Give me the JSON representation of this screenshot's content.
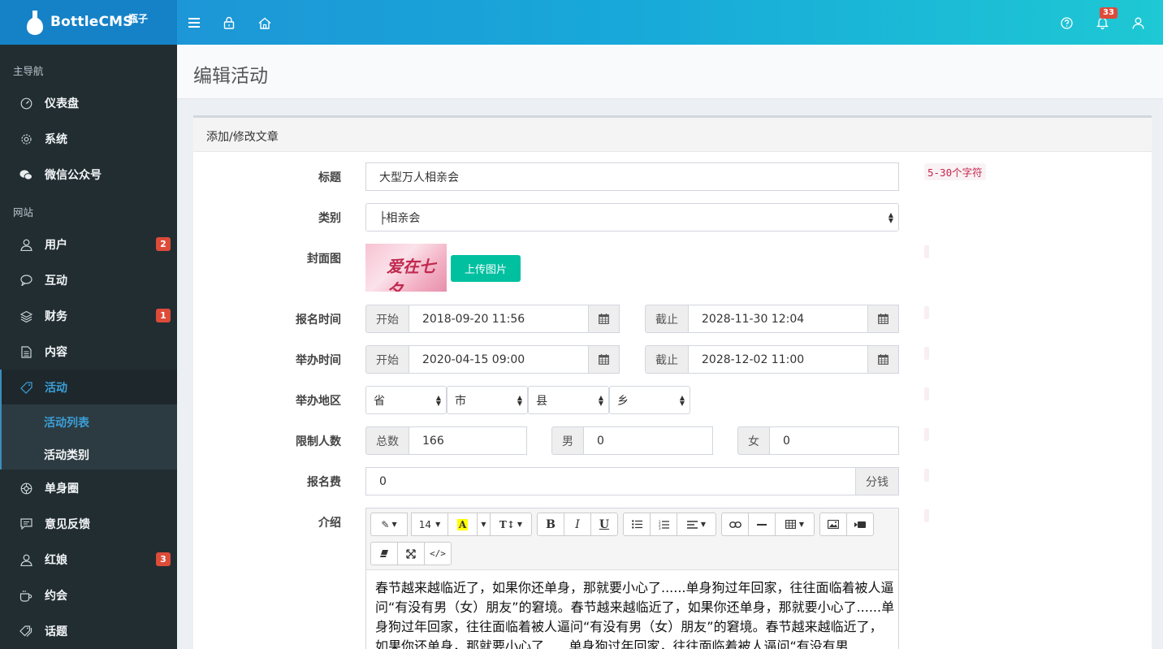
{
  "app": {
    "name": "BottleCMS",
    "name_cn": "瓶子",
    "notification_count": "33"
  },
  "sidebar": {
    "header_main": "主导航",
    "header_site": "网站",
    "items": [
      {
        "label": "仪表盘",
        "icon": "dashboard-icon"
      },
      {
        "label": "系统",
        "icon": "gear-icon"
      },
      {
        "label": "微信公众号",
        "icon": "wechat-icon"
      },
      {
        "label": "用户",
        "icon": "user-icon",
        "badge": "2"
      },
      {
        "label": "互动",
        "icon": "comment-icon"
      },
      {
        "label": "财务",
        "icon": "layers-icon",
        "badge": "1"
      },
      {
        "label": "内容",
        "icon": "file-icon"
      },
      {
        "label": "活动",
        "icon": "tag-icon"
      },
      {
        "label": "单身圈",
        "icon": "circle-icon"
      },
      {
        "label": "意见反馈",
        "icon": "message-icon"
      },
      {
        "label": "红娘",
        "icon": "user-icon",
        "badge": "3"
      },
      {
        "label": "约会",
        "icon": "coffee-icon"
      },
      {
        "label": "话题",
        "icon": "tags-icon"
      }
    ],
    "submenu": [
      "活动列表",
      "活动类别"
    ]
  },
  "page": {
    "title": "编辑活动",
    "box_title": "添加/修改文章"
  },
  "form": {
    "title_label": "标题",
    "title_value": "大型万人相亲会",
    "title_hint": "5-30个字符",
    "category_label": "类别",
    "category_value": "├相亲会",
    "cover_label": "封面图",
    "cover_text": "爱在七夕",
    "upload_label": "上传图片",
    "signup_label": "报名时间",
    "start_addon": "开始",
    "end_addon": "截止",
    "signup_start": "2018-09-20 11:56",
    "signup_end": "2028-11-30 12:04",
    "hold_label": "举办时间",
    "hold_start": "2020-04-15 09:00",
    "hold_end": "2028-12-02 11:00",
    "region_label": "举办地区",
    "province": "省",
    "city": "市",
    "county": "县",
    "town": "乡",
    "limit_label": "限制人数",
    "total_addon": "总数",
    "total_value": "166",
    "male_addon": "男",
    "male_value": "0",
    "female_addon": "女",
    "female_value": "0",
    "fee_label": "报名费",
    "fee_value": "0",
    "fee_unit": "分钱",
    "intro_label": "介绍",
    "font_size": "14",
    "intro_text": "春节越来越临近了，如果你还单身，那就要小心了......单身狗过年回家，往往面临着被人逼问“有没有男（女）朋友”的窘境。春节越来越临近了，如果你还单身，那就要小心了......单身狗过年回家，往往面临着被人逼问“有没有男（女）朋友”的窘境。春节越来越临近了，如果你还单身，那就要小心了......单身狗过年回家，往往面临着被人逼问“有没有男"
  },
  "colors": {
    "accent": "#3c8dbc",
    "sidebar_bg": "#222d32",
    "badge": "#dd4b39",
    "upload_button": "#00c0a0"
  }
}
